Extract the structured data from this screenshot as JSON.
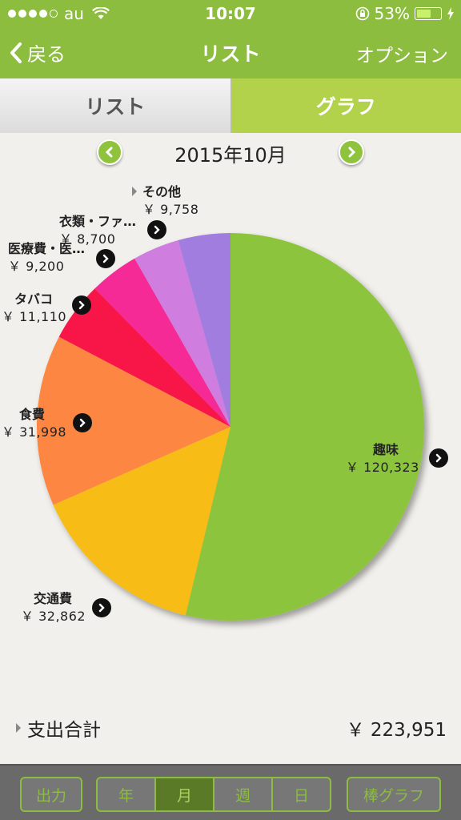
{
  "status": {
    "carrier": "au",
    "time": "10:07",
    "battery": "53%"
  },
  "nav": {
    "back": "戻る",
    "title": "リスト",
    "option": "オプション"
  },
  "tabs": {
    "list": "リスト",
    "graph": "グラフ"
  },
  "month": "2015年10月",
  "chart_data": {
    "type": "pie",
    "categories": [
      "趣味",
      "交通費",
      "食費",
      "タバコ",
      "医療費・医…",
      "衣類・ファ…",
      "その他"
    ],
    "values": [
      120323,
      32862,
      31998,
      11110,
      9200,
      8700,
      9758
    ],
    "value_labels": [
      "￥ 120,323",
      "￥ 32,862",
      "￥ 31,998",
      "￥ 11,110",
      "￥ 9,200",
      "￥ 8,700",
      "￥ 9,758"
    ],
    "colors": [
      "#8cc43e",
      "#f7bc12",
      "#fd8743",
      "#f8154a",
      "#f62c96",
      "#cf7ddf",
      "#a17de0"
    ]
  },
  "total": {
    "label": "支出合計",
    "value": "￥ 223,951"
  },
  "toolbar": {
    "export": "出力",
    "year": "年",
    "month": "月",
    "week": "週",
    "day": "日",
    "bar_graph": "棒グラフ"
  }
}
